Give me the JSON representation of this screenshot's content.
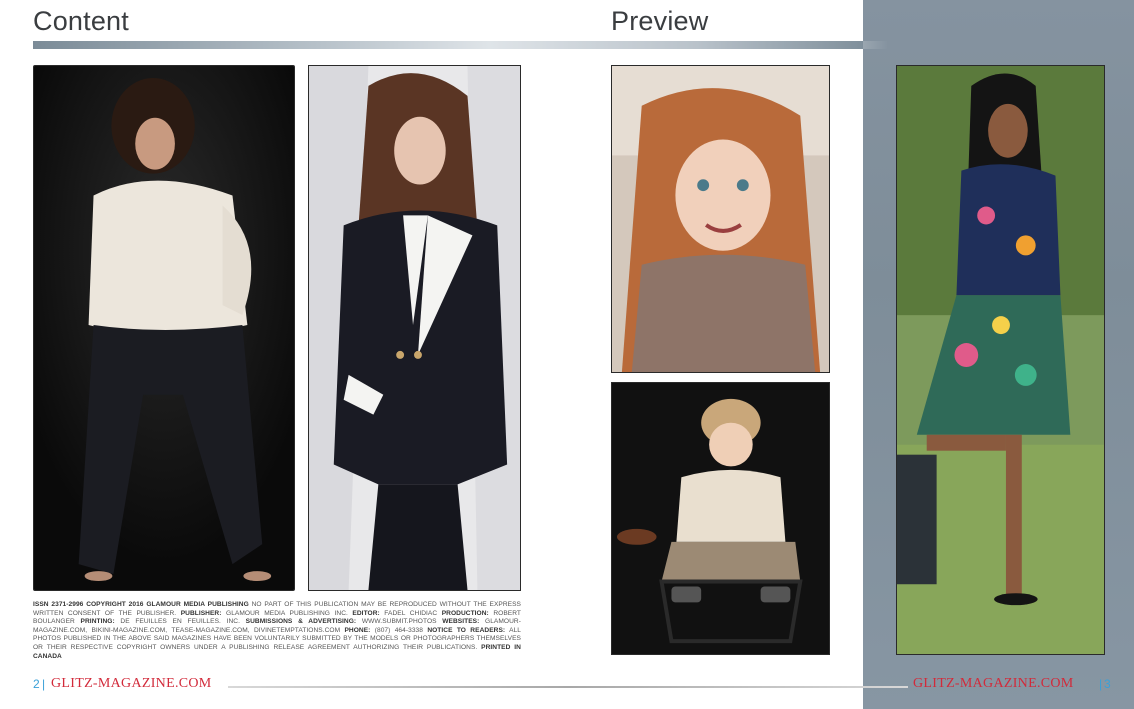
{
  "headings": {
    "content": "Content",
    "preview": "Preview"
  },
  "colophon": [
    {
      "b": "ISSN 2371-2996 COPYRIGHT 2016 GLAMOUR MEDIA PUBLISHING",
      "t": " NO PART OF THIS PUBLICATION MAY BE REPRODUCED WITHOUT THE EXPRESS WRITTEN CONSENT OF THE PUBLISHER. "
    },
    {
      "b": "PUBLISHER:",
      "t": " GLAMOUR MEDIA PUBLISHING INC. "
    },
    {
      "b": "EDITOR:",
      "t": " FADEL CHIDIAC "
    },
    {
      "b": "PRODUCTION:",
      "t": " ROBERT BOULANGER "
    },
    {
      "b": "PRINTING:",
      "t": " DE FEUILLES EN FEUILLES. INC. "
    },
    {
      "b": "SUBMISSIONS & ADVERTISING:",
      "t": " WWW.SUBMIT.PHOTOS "
    },
    {
      "b": "WEBSITES:",
      "t": " GLAMOUR-MAGAZINE.COM, BIKINI-MAGAZINE.COM, TEASE-MAGAZINE.COM, DIVINETEMPTATIONS.COM "
    },
    {
      "b": "PHONE:",
      "t": " (807) 464-3338 "
    },
    {
      "b": "NOTICE TO READERS:",
      "t": " ALL PHOTOS PUBLISHED IN THE ABOVE SAID MAGAZINES HAVE BEEN VOLUNTARILY SUBMITTED BY THE MODELS OR PHOTOGRAPHERS THEMSELVES OR THEIR RESPECTIVE COPYRIGHT OWNERS UNDER A PUBLISHING RELEASE AGREEMENT AUTHORIZING THEIR PUBLICATIONS. "
    },
    {
      "b": "PRINTED IN CANADA",
      "t": ""
    }
  ],
  "footer": {
    "left_page": "2",
    "left_sep": "|",
    "left_brand": "GLITZ-MAGAZINE.COM",
    "right_brand": "GLITZ-MAGAZINE.COM",
    "right_sep": "|",
    "right_page": "3"
  },
  "colors": {
    "brand": "#d22a3a",
    "page_number": "#3aa0d8",
    "panel": "#8593a0"
  }
}
